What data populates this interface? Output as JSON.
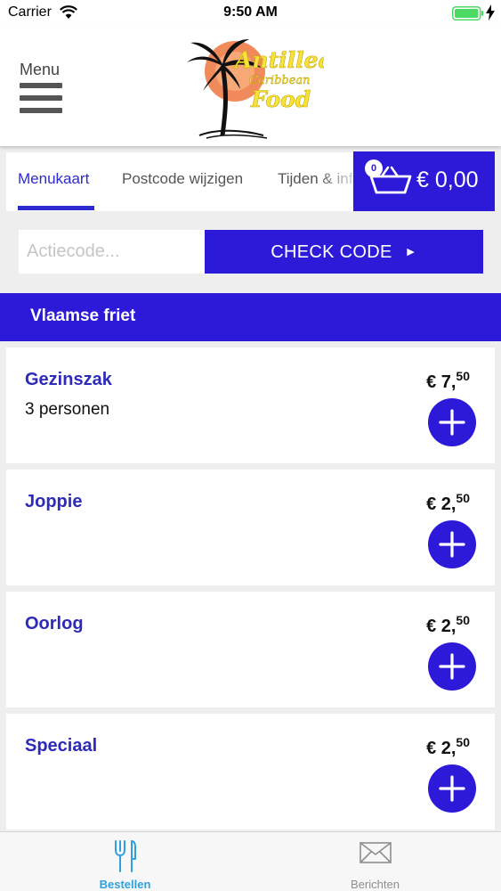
{
  "status": {
    "carrier": "Carrier",
    "time": "9:50 AM"
  },
  "header": {
    "menu_label": "Menu",
    "logo_line1": "Antillean",
    "logo_line2": "Caribbean",
    "logo_line3": "Food"
  },
  "tabs": [
    {
      "label": "Menukaart",
      "active": true
    },
    {
      "label": "Postcode wijzigen",
      "active": false
    },
    {
      "label": "Tijden & informatie",
      "active": false
    }
  ],
  "cart": {
    "count": "0",
    "total": "€ 0,00"
  },
  "promo": {
    "placeholder": "Actiecode...",
    "button_label": "CHECK CODE",
    "button_arrow": "►"
  },
  "category": {
    "title": "Vlaamse friet"
  },
  "products": [
    {
      "name": "Gezinszak",
      "description": "3 personen",
      "price_main": "€ 7,",
      "price_cents": "50"
    },
    {
      "name": "Joppie",
      "description": "",
      "price_main": "€ 2,",
      "price_cents": "50"
    },
    {
      "name": "Oorlog",
      "description": "",
      "price_main": "€ 2,",
      "price_cents": "50"
    },
    {
      "name": "Speciaal",
      "description": "",
      "price_main": "€ 2,",
      "price_cents": "50"
    }
  ],
  "tabbar": [
    {
      "label": "Bestellen",
      "active": true,
      "icon": "fork-knife-icon"
    },
    {
      "label": "Berichten",
      "active": false,
      "icon": "envelope-icon"
    }
  ],
  "colors": {
    "primary": "#2d1ad9",
    "product_name": "#2d2bb8",
    "tab_active": "#2ea0dc"
  }
}
